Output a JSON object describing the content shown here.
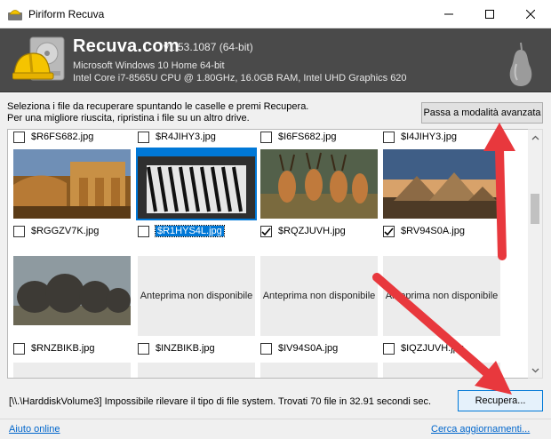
{
  "window": {
    "title": "Piriform Recuva"
  },
  "header": {
    "brand": "Recuva.com",
    "version": "v1.53.1087 (64-bit)",
    "os_line": "Microsoft Windows 10 Home 64-bit",
    "hw_line": "Intel Core i7-8565U CPU @ 1.80GHz, 16.0GB RAM, Intel UHD Graphics 620"
  },
  "instructions": {
    "line1": "Seleziona i file da recuperare spuntando le caselle e premi Recupera.",
    "line2": "Per una migliore riuscita, ripristina i file su un altro drive."
  },
  "advanced_button": "Passa a modalità avanzata",
  "grid": {
    "top_row_names": [
      "$R6FS682.jpg",
      "$R4JIHY3.jpg",
      "$I6FS682.jpg",
      "$I4JIHY3.jpg"
    ],
    "row2": [
      {
        "name": "$RGGZV7K.jpg",
        "checked": false,
        "selected": false,
        "preview": "desert-temple"
      },
      {
        "name": "$R1HYS4L.jpg",
        "checked": false,
        "selected": true,
        "preview": "zebras"
      },
      {
        "name": "$RQZJUVH.jpg",
        "checked": true,
        "selected": false,
        "preview": "gazelles"
      },
      {
        "name": "$RV94S0A.jpg",
        "checked": true,
        "selected": false,
        "preview": "pyramids"
      }
    ],
    "row3": [
      {
        "name": "$RNZBIKB.jpg",
        "checked": false,
        "preview": "elephants",
        "placeholder": ""
      },
      {
        "name": "$INZBIKB.jpg",
        "checked": false,
        "preview": "",
        "placeholder": "Anteprima non disponibile"
      },
      {
        "name": "$IV94S0A.jpg",
        "checked": false,
        "preview": "",
        "placeholder": "Anteprima non disponibile"
      },
      {
        "name": "$IQZJUVH.jpg",
        "checked": false,
        "preview": "",
        "placeholder": "Anteprima non disponibile"
      }
    ]
  },
  "status": "[\\\\.\\HarddiskVolume3] Impossibile rilevare il tipo di file system. Trovati 70 file in 32.91 secondi sec.",
  "recover_button": "Recupera...",
  "footer": {
    "help_link": "Aiuto online",
    "update_link": "Cerca aggiornamenti..."
  },
  "colors": {
    "banner": "#4a4a4a",
    "accent": "#0078d7",
    "annotation_arrow": "#e8383d"
  }
}
